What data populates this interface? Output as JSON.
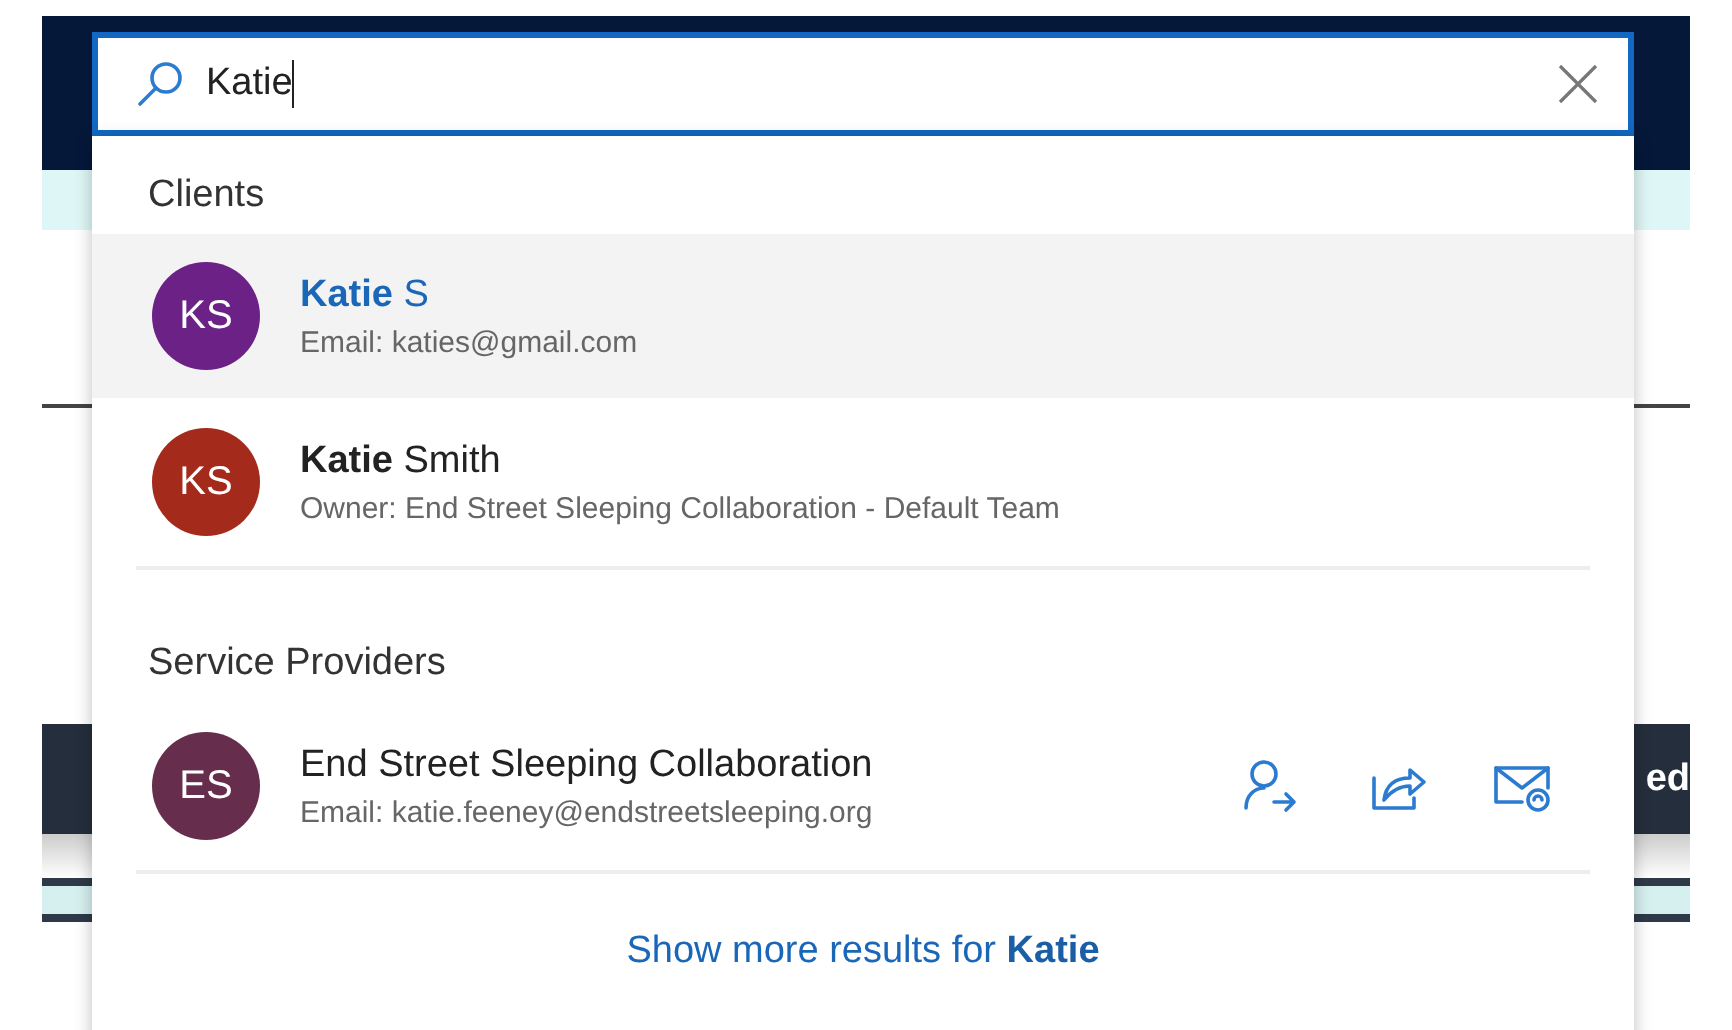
{
  "search": {
    "value": "Katie"
  },
  "background": {
    "button_label": "ed"
  },
  "groups": [
    {
      "title": "Clients",
      "items": [
        {
          "initials": "KS",
          "color": "#6b2186",
          "name": "**Katie** S",
          "detail": "Email: katies@gmail.com",
          "selected": true
        },
        {
          "initials": "KS",
          "color": "#a42a1b",
          "name": "**Katie** Smith",
          "detail": "Owner: End Street Sleeping Collaboration - Default Team",
          "selected": false
        }
      ]
    },
    {
      "title": "Service Providers",
      "items": [
        {
          "initials": "ES",
          "color": "#662d4c",
          "name": "End Street Sleeping Collaboration",
          "detail": "Email: katie.feeney@endstreetsleeping.org",
          "selected": false,
          "actions": [
            {
              "kind": "assign"
            },
            {
              "kind": "share"
            },
            {
              "kind": "email"
            }
          ]
        }
      ]
    }
  ],
  "more": "Show more results for **Katie**"
}
